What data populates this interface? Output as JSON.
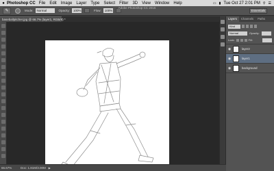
{
  "menubar": {
    "apple": "",
    "app_name": "Photoshop CC",
    "items": [
      "File",
      "Edit",
      "Image",
      "Layer",
      "Type",
      "Select",
      "Filter",
      "3D",
      "View",
      "Window",
      "Help"
    ],
    "clock": "Tue Oct 27  2:01 PM",
    "right_icons": [
      "display-icon",
      "battery-icon",
      "spotlight-icon",
      "list-icon"
    ]
  },
  "window_title": "Adobe Photoshop CC 2015",
  "options": {
    "mode_label": "Mode:",
    "mode_value": "Normal",
    "opacity_label": "Opacity:",
    "opacity_value": "100%",
    "flow_label": "Flow:",
    "flow_value": "100%",
    "workspace": "Essentials"
  },
  "document": {
    "tab": "baseballpitcher.jpg @ 66.7% (layer1, RGB/8) *"
  },
  "statusbar": {
    "zoom": "66.67%",
    "doc_size": "Doc: 1.81M/3.00M"
  },
  "layers_panel": {
    "tabs": [
      "Layers",
      "Channels",
      "Paths"
    ],
    "active_tab": "Layers",
    "kind_label": "Kind",
    "blend_mode": "Normal",
    "opacity_label": "Opacity:",
    "lock_label": "Lock:",
    "fill_label": "Fill:",
    "layers": [
      {
        "name": "layer2",
        "visible": true,
        "selected": false
      },
      {
        "name": "layer1",
        "visible": true,
        "selected": true
      },
      {
        "name": "background",
        "visible": true,
        "selected": false
      }
    ]
  },
  "colors": {
    "accent": "#5e6e82",
    "workspace_bg": "#282828",
    "panel_bg": "#535353"
  }
}
